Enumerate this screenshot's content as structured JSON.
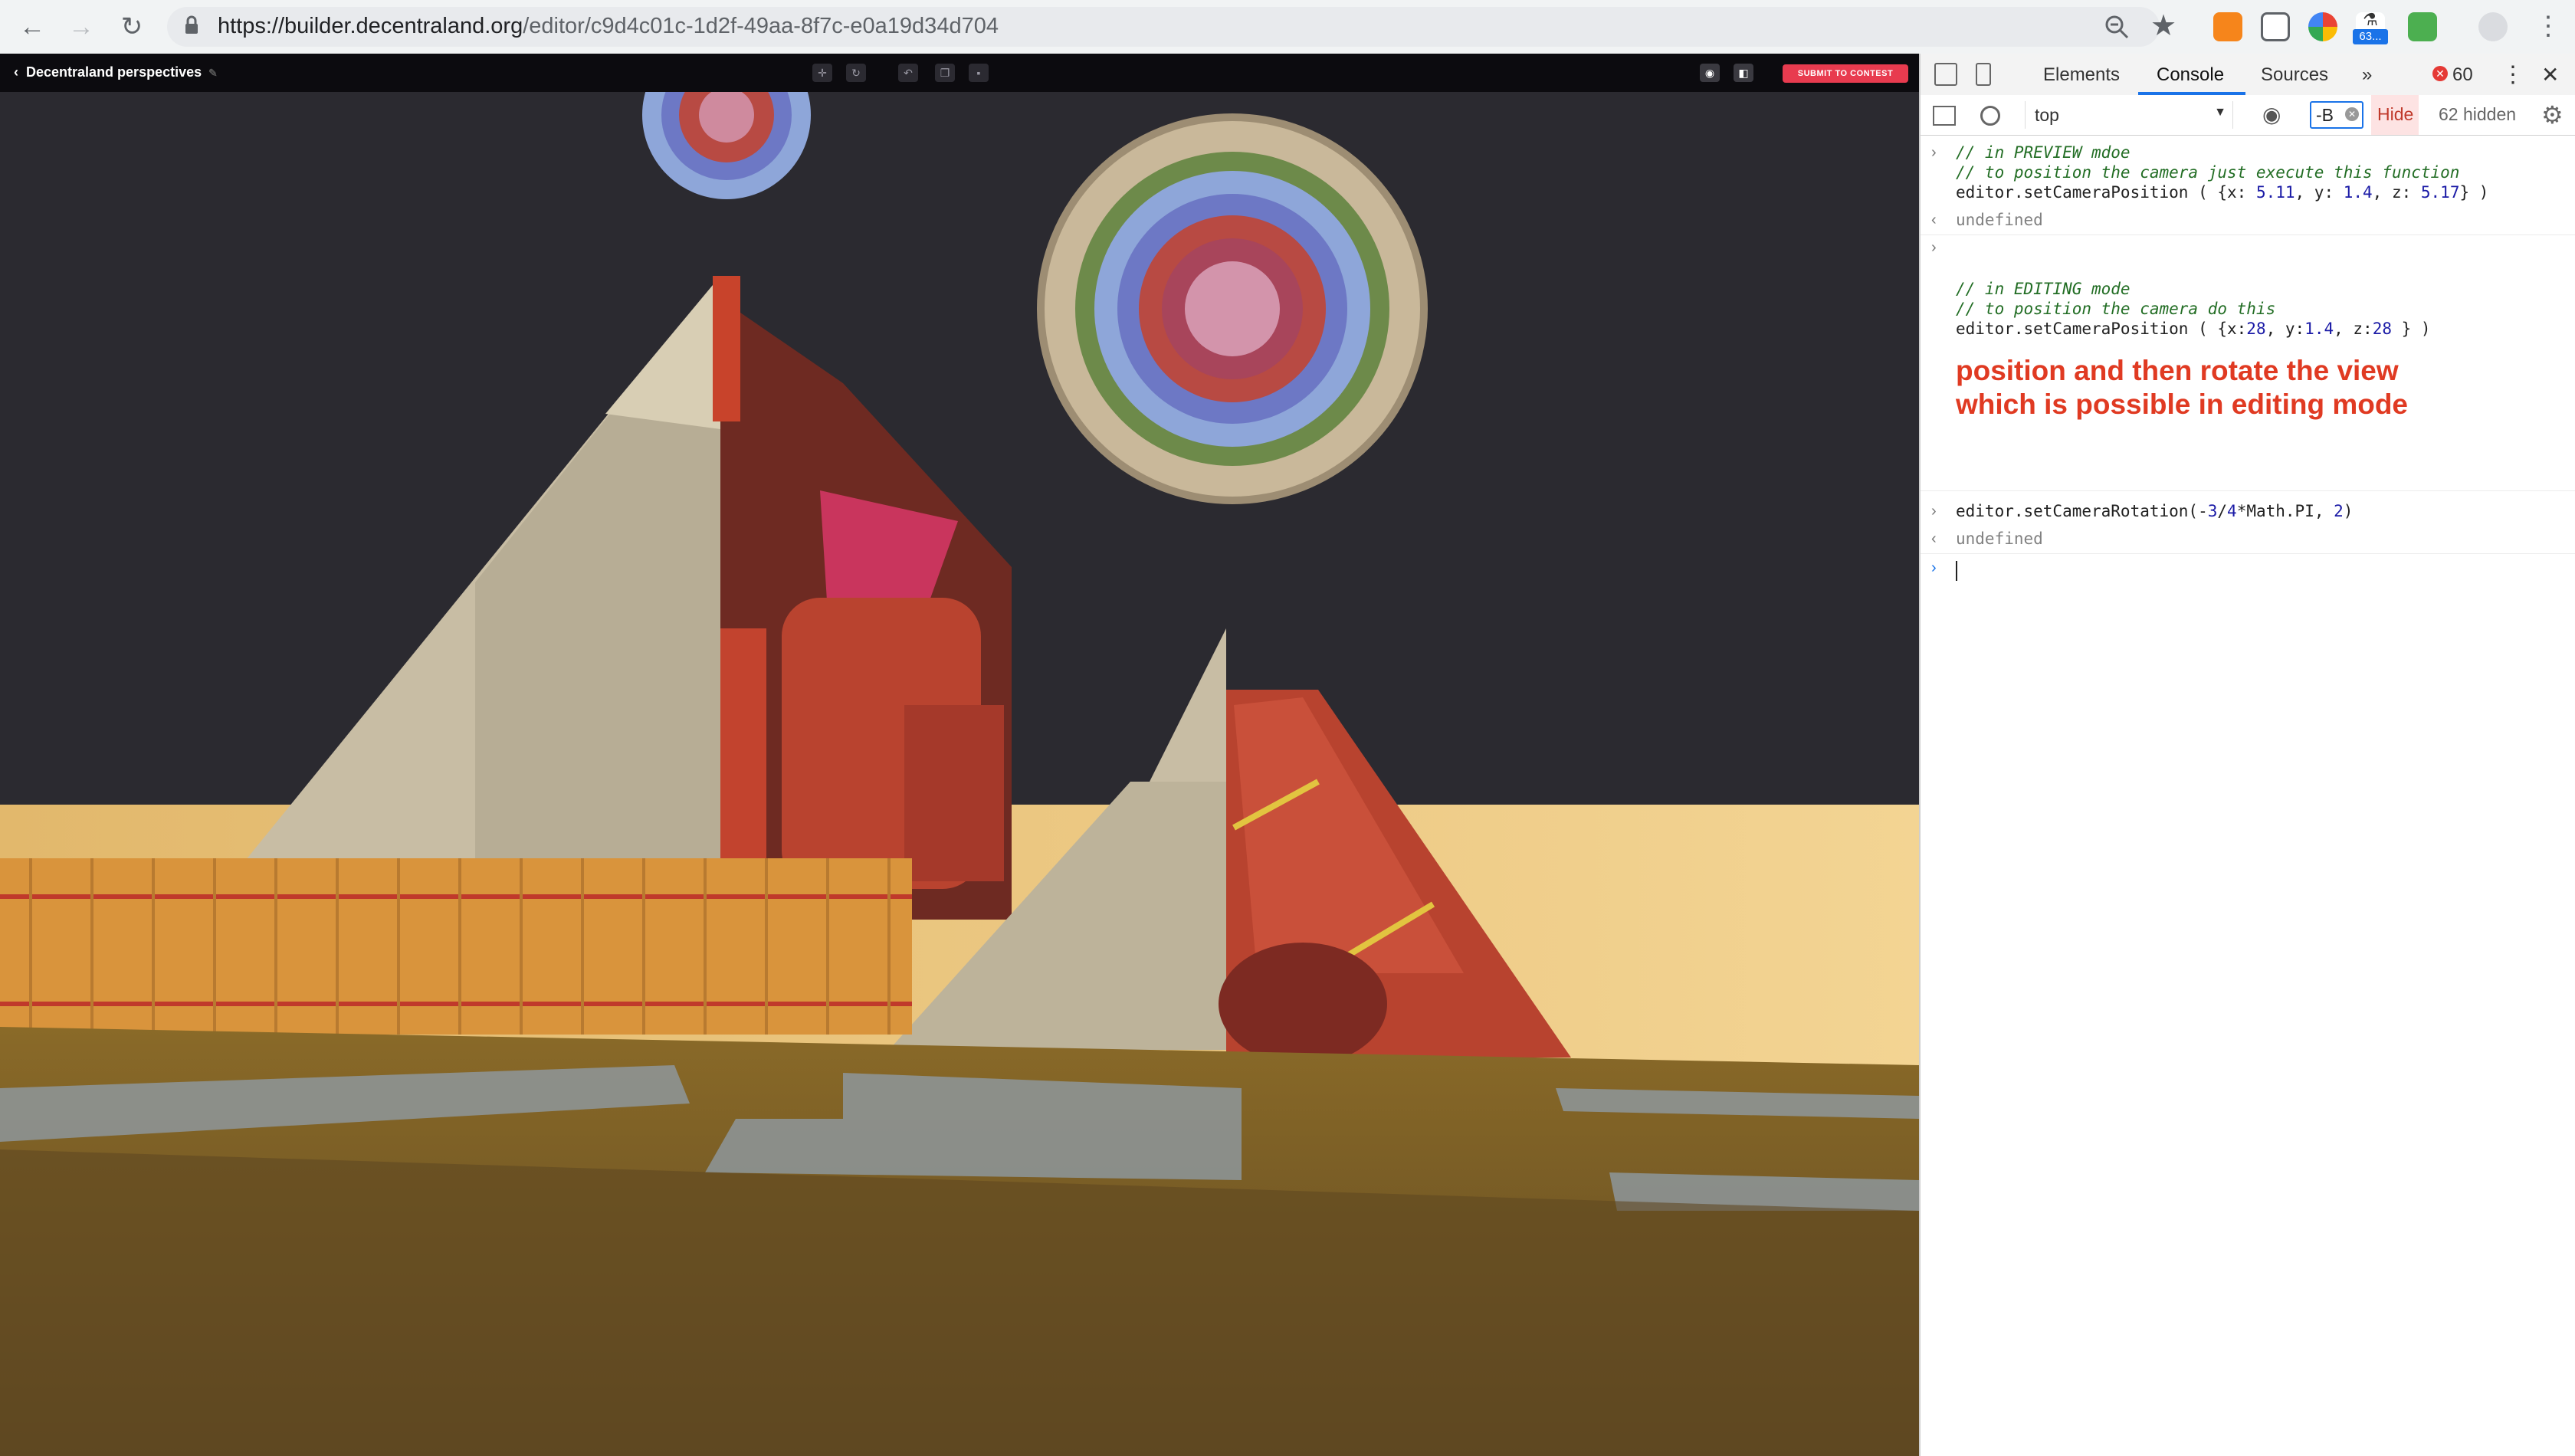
{
  "browser": {
    "url_host": "https://builder.decentraland.org",
    "url_path": "/editor/c9d4c01c-1d2f-49aa-8f7c-e0a19d34d704",
    "extension_badge": "63..."
  },
  "editor": {
    "back_label": "‹",
    "scene_title": "Decentraland perspectives",
    "submit_label": "SUBMIT TO CONTEST"
  },
  "devtools": {
    "tabs": [
      "Elements",
      "Console",
      "Sources"
    ],
    "more_tabs": "»",
    "error_count": "60",
    "context": "top",
    "filter_value": "-B",
    "hide_label": "Hide",
    "hidden_count": "62 hidden",
    "console": {
      "c1": "// in PREVIEW mdoe",
      "c2": "// to position the camera just execute this function",
      "cmd1_prefix": "editor.setCameraPosition ( {x: ",
      "cmd1_x": "5.11",
      "cmd1_ysep": ", y: ",
      "cmd1_y": "1.4",
      "cmd1_zsep": ", z: ",
      "cmd1_z": "5.17",
      "cmd1_suffix": "} )",
      "result1": "undefined",
      "c3": "// in EDITING mode",
      "c4": "// to position the camera do this",
      "cmd2_prefix": "editor.setCameraPosition ( {x:",
      "cmd2_x": "28",
      "cmd2_ysep": ", y:",
      "cmd2_y": "1.4",
      "cmd2_zsep": ", z:",
      "cmd2_z": "28",
      "cmd2_suffix": " } )",
      "note1": "position and then rotate the view",
      "note2": "which is possible in editing mode",
      "cmd3_prefix": "editor.setCameraRotation(-",
      "cmd3_a": "3",
      "cmd3_slash": "/",
      "cmd3_b": "4",
      "cmd3_mid": "*Math.PI, ",
      "cmd3_c": "2",
      "cmd3_suffix": ")",
      "result3": "undefined"
    }
  }
}
